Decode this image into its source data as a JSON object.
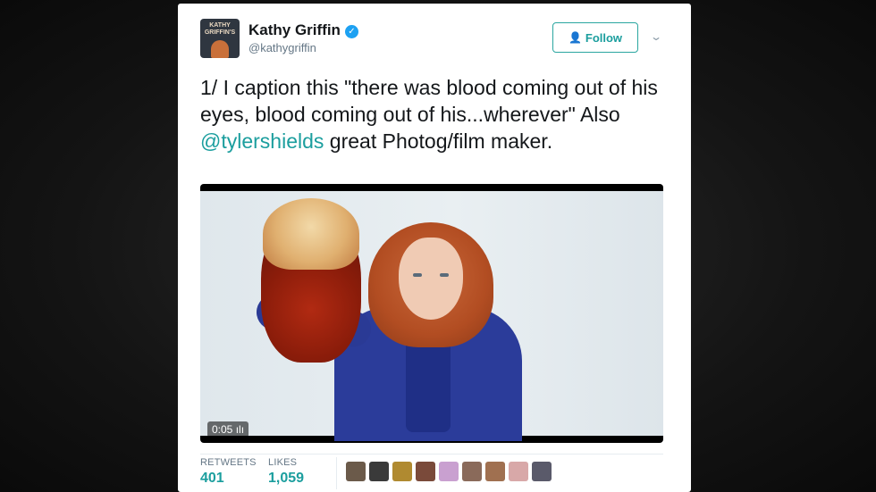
{
  "tweet": {
    "author": {
      "name": "Kathy Griffin",
      "handle": "@kathygriffin",
      "verified": true,
      "avatar_icon": "avatar-kathy-griffin",
      "avatar_text": "KATHY GRIFFIN'S"
    },
    "follow_label": "Follow",
    "follow_icon": "add-user-icon",
    "more_icon": "chevron-down-icon",
    "text_part1": "1/ I caption this \"there was blood coming out of his eyes, blood coming out of his...wherever\" Also ",
    "mention": "@tylershields",
    "text_part2": " great Photog/film maker.",
    "video": {
      "duration": "0:05",
      "duration_icon": "volume-bars-icon"
    },
    "stats": {
      "retweets_label": "RETWEETS",
      "retweets_value": "401",
      "likes_label": "LIKES",
      "likes_value": "1,059"
    },
    "liker_count_shown": 9
  },
  "colors": {
    "accent": "#1b9e9e",
    "verified": "#1da1f2",
    "text": "#14171a",
    "muted": "#657786"
  }
}
